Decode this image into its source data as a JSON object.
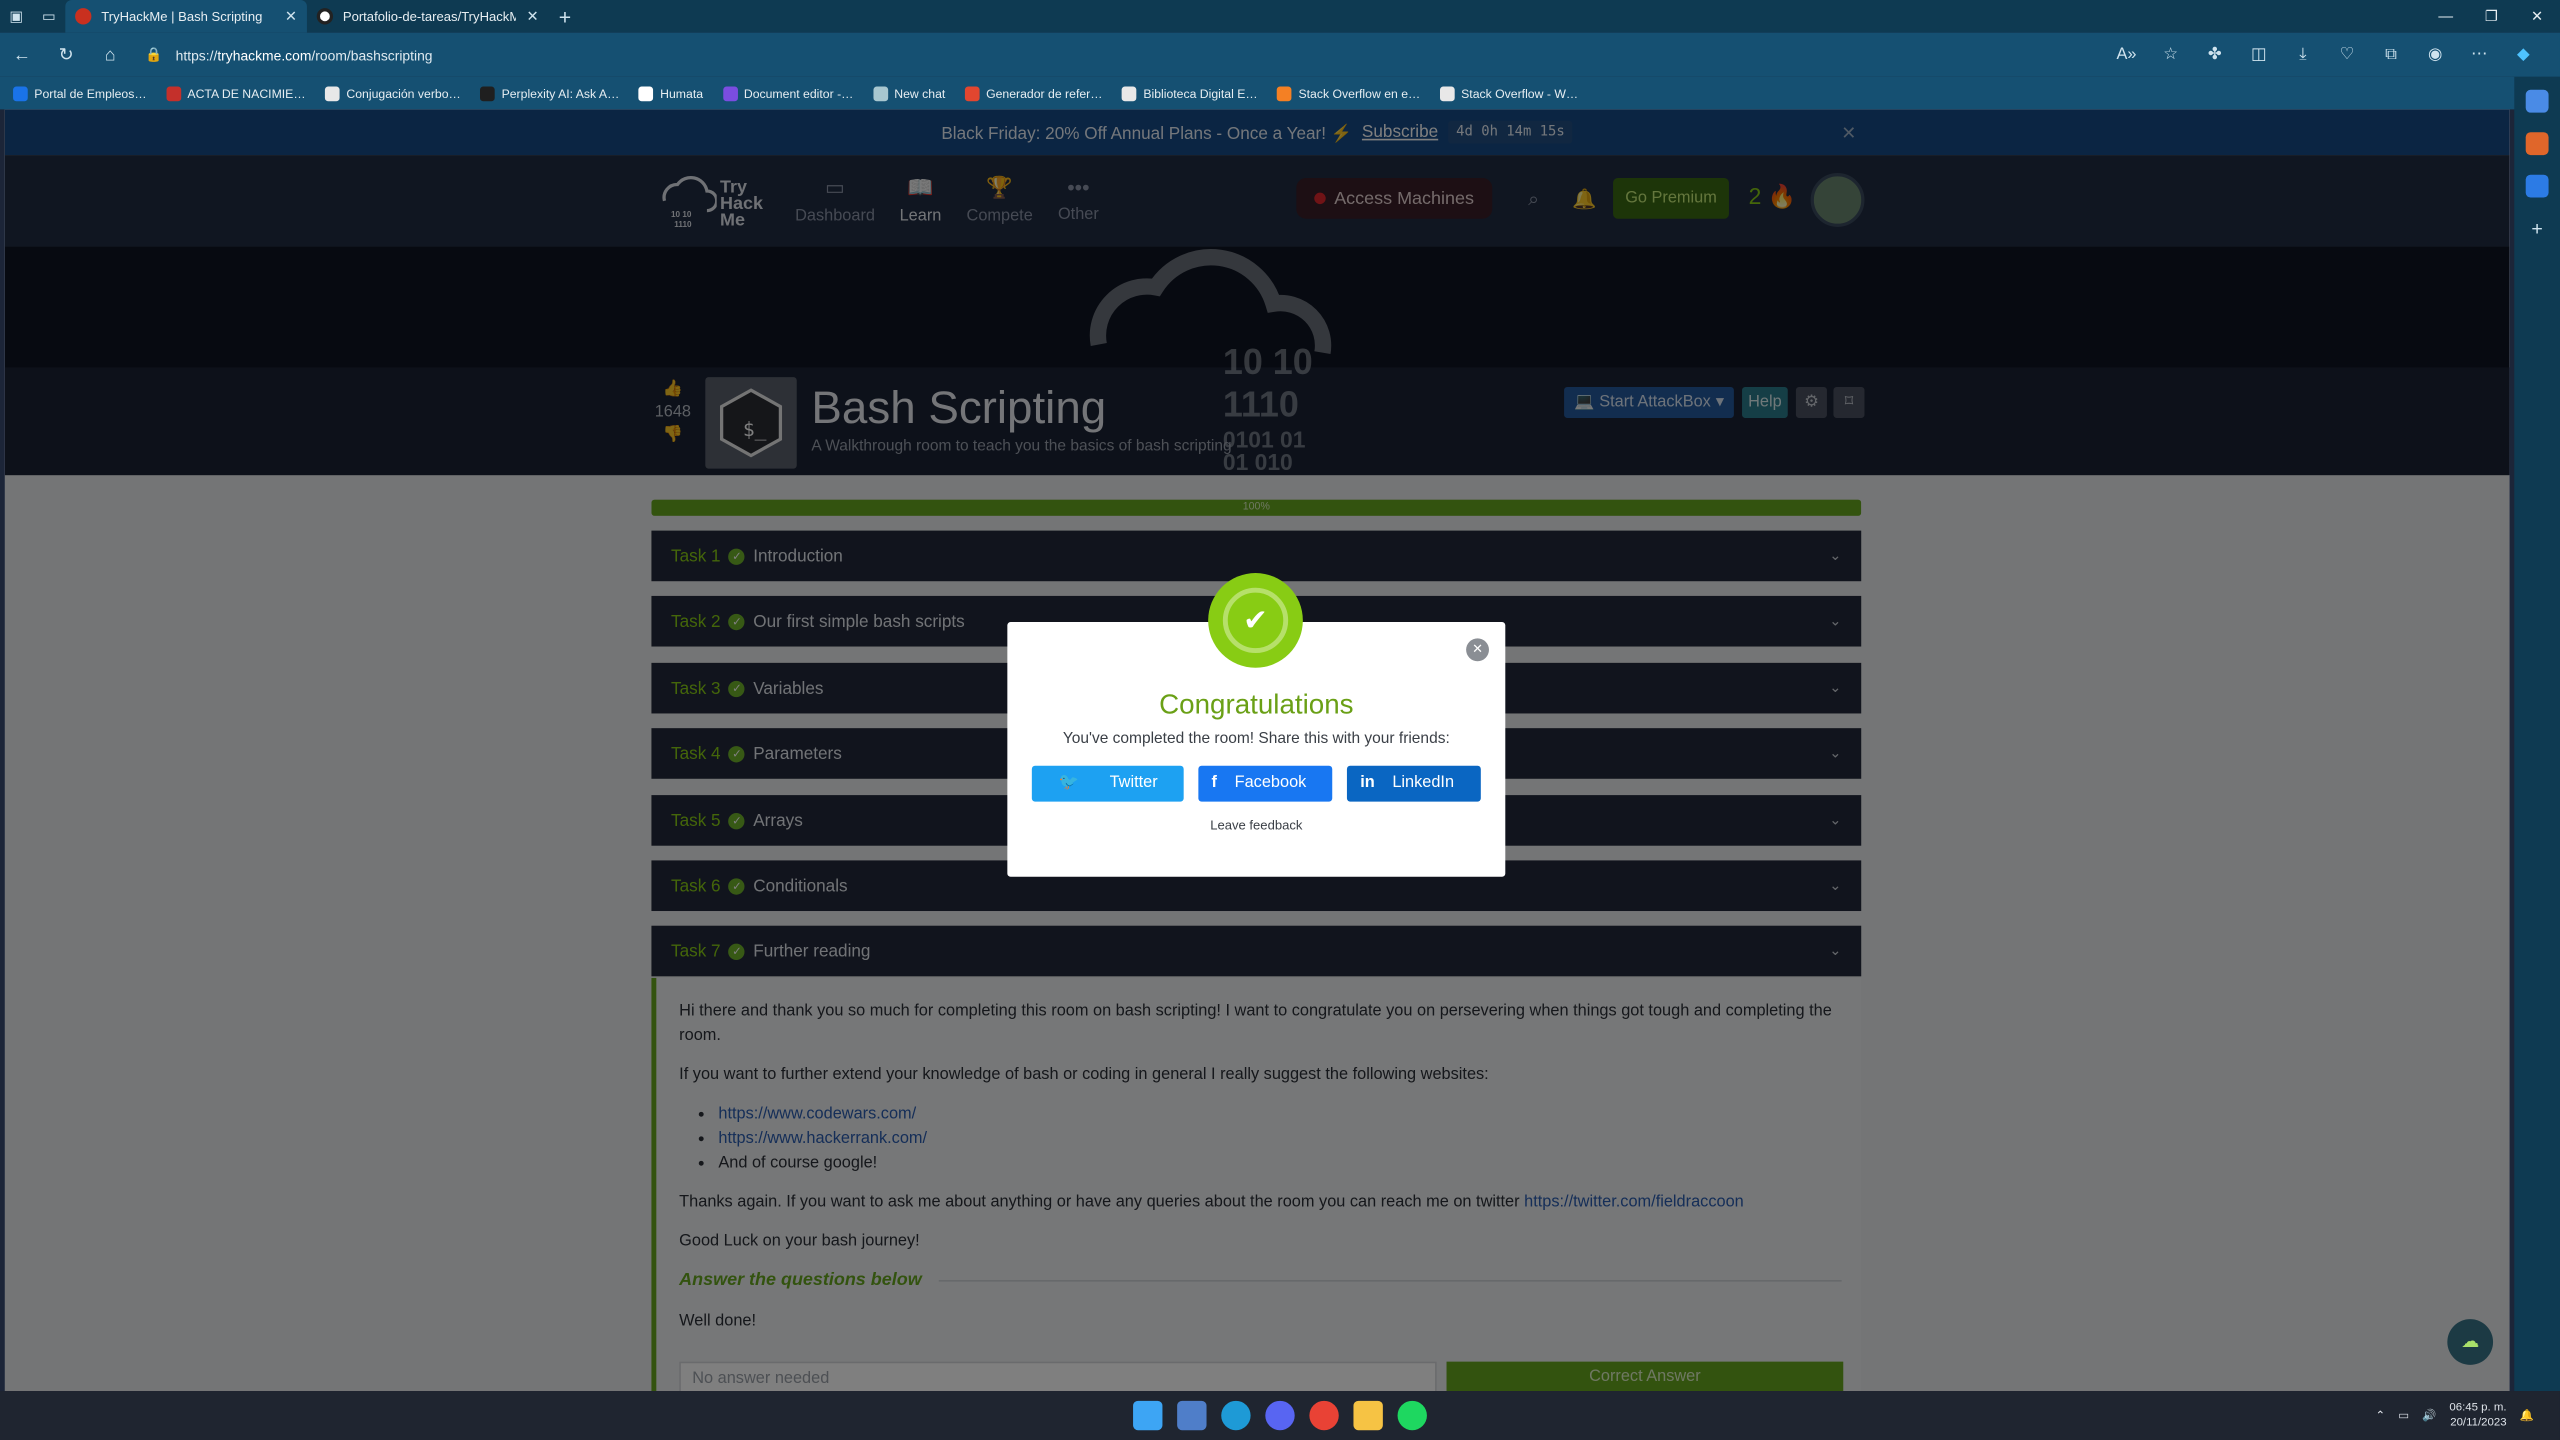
{
  "browser": {
    "tabs": [
      {
        "label": "TryHackMe | Bash Scripting",
        "active": true
      },
      {
        "label": "Portafolio-de-tareas/TryHackMe/…",
        "active": false
      }
    ],
    "url_prefix": "https://",
    "url_host": "tryhackme.com",
    "url_path": "/room/bashscripting",
    "bookmarks": [
      "Portal de Empleos…",
      "ACTA DE NACIMIE…",
      "Conjugación verbo…",
      "Perplexity AI: Ask A…",
      "Humata",
      "Document editor -…",
      "New chat",
      "Generador de refer…",
      "Biblioteca Digital E…",
      "Stack Overflow en e…",
      "Stack Overflow - W…"
    ],
    "bookmark_colors": [
      "#1a73e8",
      "#c4302b",
      "#e8e8e8",
      "#1f1f1f",
      "#ffffff",
      "#7b4de0",
      "#a8c7d0",
      "#e2462f",
      "#e8e8e8",
      "#f48024",
      "#e8e8e8"
    ]
  },
  "promo": {
    "text": "Black Friday: 20% Off Annual Plans - Once a Year! ⚡",
    "link": "Subscribe",
    "timer": "4d 0h 14m 15s"
  },
  "nav": {
    "logo_lines": [
      "Try",
      "Hack",
      "Me"
    ],
    "items": [
      "Dashboard",
      "Learn",
      "Compete",
      "Other"
    ],
    "access": "Access Machines",
    "premium": "Go Premium",
    "streak": "2"
  },
  "room": {
    "votes": "1648",
    "title": "Bash Scripting",
    "subtitle": "A Walkthrough room to teach you the basics of bash scripting",
    "attackbox": "Start AttackBox",
    "help": "Help",
    "progress_label": "100%",
    "progress": 1.0,
    "art_digits": [
      "10 10",
      "1110",
      "0101 01",
      "01 010"
    ]
  },
  "tasks": [
    {
      "num": "Task 1",
      "title": "Introduction"
    },
    {
      "num": "Task 2",
      "title": "Our first simple bash scripts"
    },
    {
      "num": "Task 3",
      "title": "Variables"
    },
    {
      "num": "Task 4",
      "title": "Parameters"
    },
    {
      "num": "Task 5",
      "title": "Arrays"
    },
    {
      "num": "Task 6",
      "title": "Conditionals"
    },
    {
      "num": "Task 7",
      "title": "Further reading"
    }
  ],
  "task7": {
    "p1": "Hi there and thank you so much for completing this room on bash scripting! I want to congratulate you on persevering when things got tough and completing the room.",
    "p2": "If you want to further extend your knowledge of bash or coding in general I really suggest the following websites:",
    "links": [
      "https://www.codewars.com/",
      "https://www.hackerrank.com/"
    ],
    "item3": "And of course google!",
    "p3": "Thanks again. If you want to ask me about anything or have any queries about the room you can reach me on twitter ",
    "twitter": "https://twitter.com/fieldraccoon",
    "p4": "Good Luck on your bash journey!",
    "answer_heading": "Answer the questions below",
    "well_done": "Well done!",
    "answer_placeholder": "No answer needed",
    "correct": "Correct Answer"
  },
  "modal": {
    "title": "Congratulations",
    "text": "You've completed the room! Share this with your friends:",
    "buttons": [
      "Twitter",
      "Facebook",
      "LinkedIn"
    ],
    "feedback": "Leave feedback",
    "colors": {
      "twitter": "#1da1f2",
      "facebook": "#1877f2",
      "linkedin": "#0a66c2"
    }
  },
  "taskbar": {
    "time": "06:45 p. m.",
    "date": "20/11/2023"
  }
}
